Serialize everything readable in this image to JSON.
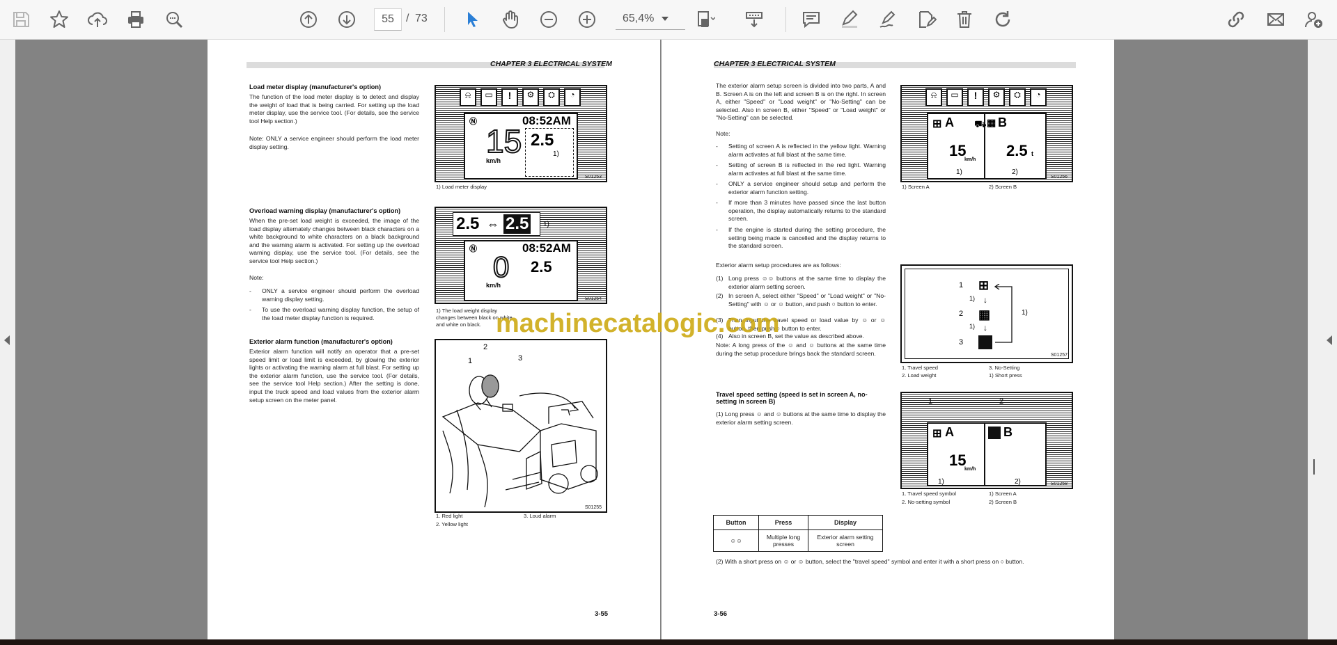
{
  "toolbar": {
    "page_current": "55",
    "page_separator": "/",
    "page_total": "73",
    "zoom": "65,4%",
    "accent_color": "#2b7fd6",
    "icons": [
      "save-icon",
      "bookmark-star-icon",
      "upload-cloud-icon",
      "print-icon",
      "zoom-search-icon",
      "page-up-icon",
      "page-down-icon",
      "select-cursor-icon",
      "hand-pan-icon",
      "zoom-out-icon",
      "zoom-in-icon",
      "fit-page-icon",
      "scan-icon",
      "comment-icon",
      "highlight-pen-icon",
      "sign-icon",
      "edit-document-icon",
      "delete-icon",
      "rotate-icon",
      "share-link-icon",
      "email-icon",
      "add-user-icon"
    ]
  },
  "watermark": "machinecatalogic.com",
  "left_page": {
    "chapter": "CHAPTER 3 ELECTRICAL SYSTEM",
    "page_number": "3-55",
    "s1_heading": "Load meter display (manufacturer's option)",
    "s1_body": "The function of the load meter display is to detect and display the weight of load that is being carried. For setting up the load meter display, use the service tool. (For details, see the service tool Help section.)",
    "s1_note": "Note: ONLY a service engineer should perform the load meter display setting.",
    "fig1_caption": "1) Load meter display",
    "fig1_code": "S01253",
    "fig1_time": "08:52AM",
    "fig1_speed": "15",
    "fig1_load": "2.5",
    "fig1_unit": "km/h",
    "fig1_label": "1)",
    "s2_heading": "Overload warning display (manufacturer's option)",
    "s2_body": "When the pre-set load weight is exceeded, the image of the load display alternately changes between black characters on a white background to white characters on a black background and the warning alarm is activated. For setting up the overload warning display, use the service tool. (For details, see the service tool Help section.)",
    "s2_note_label": "Note:",
    "s2_notes": [
      "ONLY a service engineer should perform the overload warning display setting.",
      "To use the overload warning display function, the setup of the load meter display function is required."
    ],
    "fig2_caption": "1) The load weight display changes between black on white and white on black.",
    "fig2_code": "S01254",
    "fig2_load_a": "2.5",
    "fig2_arrow": "⇔",
    "fig2_load_b": "2.5",
    "fig2_label": "1)",
    "fig2_time": "08:52AM",
    "fig2_speed": "0",
    "fig2_load": "2.5",
    "fig2_unit": "km/h",
    "s3_heading": "Exterior alarm function (manufacturer's option)",
    "s3_body": "Exterior alarm function will notify an operator that a pre-set speed limit or load limit is exceeded, by glowing the exterior lights or activating the warning alarm at full blast. For setting up the exterior alarm function, use the service tool. (For details, see the service tool Help section.) After the setting is done, input the truck speed and load values from the exterior alarm setup screen on the meter panel.",
    "fig3_code": "S01255",
    "fig3_labels": [
      "1",
      "2",
      "3"
    ],
    "fig3_legend_1": "1. Red light",
    "fig3_legend_2": "2. Yellow light",
    "fig3_legend_3": "3. Loud alarm"
  },
  "right_page": {
    "chapter": "CHAPTER 3 ELECTRICAL SYSTEM",
    "page_number": "3-56",
    "intro": "The exterior alarm setup screen is divided into two parts, A and B. Screen A is on the left and screen B is on the right. In screen A, either \"Speed\" or \"Load weight\" or \"No-Setting\" can be selected. Also in screen B, either \"Speed\" or \"Load weight\" or \"No-Setting\" can be selected.",
    "note_label": "Note:",
    "notes": [
      "Setting of screen A is reflected in the yellow light. Warning alarm activates at full blast at the same time.",
      "Setting of screen B is reflected in the red light. Warning alarm activates at full blast at the same time.",
      "ONLY a service engineer should setup and perform the exterior alarm function setting.",
      "If more than 3 minutes have passed since the last button operation, the display automatically returns to the standard screen.",
      "If the engine is started during the setting procedure, the setting being made is cancelled and the display returns to the standard screen."
    ],
    "procedures_intro": "Exterior alarm setup procedures are as follows:",
    "steps": [
      {
        "num": "(1)",
        "text": "Long press ☺☺ buttons at the same time to display the exterior alarm setting screen."
      },
      {
        "num": "(2)",
        "text": "In screen A, select either \"Speed\" or \"Load weight\" or \"No-Setting\" with ☺ or ☺ button, and push ○ button to enter."
      },
      {
        "num": "(3)",
        "text": "Then input the travel speed or load value by ☺ or ☺ button, then push ○ button to enter."
      },
      {
        "num": "(4)",
        "text": "Also in screen B, set the value as described above."
      }
    ],
    "step_note": "Note: A long press of the ☺ and ☺ buttons at the same time during the setup procedure brings back the standard screen.",
    "fig1_code": "S01256",
    "fig1_a": "A",
    "fig1_b": "B",
    "fig1_speed": "15",
    "fig1_load": "2.5",
    "fig1_unit": "km/h",
    "fig1_t": "t",
    "fig1_label1": "1)",
    "fig1_label2": "2)",
    "fig1_cap_1": "1) Screen A",
    "fig1_cap_2": "2) Screen B",
    "fig2_code": "S01257",
    "fig2_nums": [
      "1",
      "2",
      "3"
    ],
    "fig2_labels": [
      "1)",
      "1)",
      "1)"
    ],
    "fig2_cap_1": "1. Travel speed",
    "fig2_cap_2": "2. Load weight",
    "fig2_cap_3": "3. No-Setting",
    "fig2_cap_4": "1) Short press",
    "s2_heading": "Travel speed setting (speed is set in screen A, no-setting in screen B)",
    "s2_step": "(1)  Long press ☺ and ☺ buttons at the same time to display the exterior alarm setting screen.",
    "fig3_code": "S01258",
    "fig3_nums": [
      "1",
      "2"
    ],
    "fig3_a": "A",
    "fig3_b": "B",
    "fig3_speed": "15",
    "fig3_unit": "km/h",
    "fig3_label1": "1)",
    "fig3_label2": "2)",
    "fig3_cap_1": "1. Travel speed symbol",
    "fig3_cap_2": "2. No-setting symbol",
    "fig3_cap_3": "1) Screen A",
    "fig3_cap_4": "2) Screen B",
    "table": {
      "headers": [
        "Button",
        "Press",
        "Display"
      ],
      "row": [
        "☺☺",
        "Multiple long presses",
        "Exterior alarm setting screen"
      ]
    },
    "s2_step2": "(2)  With a short press on ☺ or ☺ button, select the \"travel speed\" symbol and enter it with a short press on ○ button."
  }
}
